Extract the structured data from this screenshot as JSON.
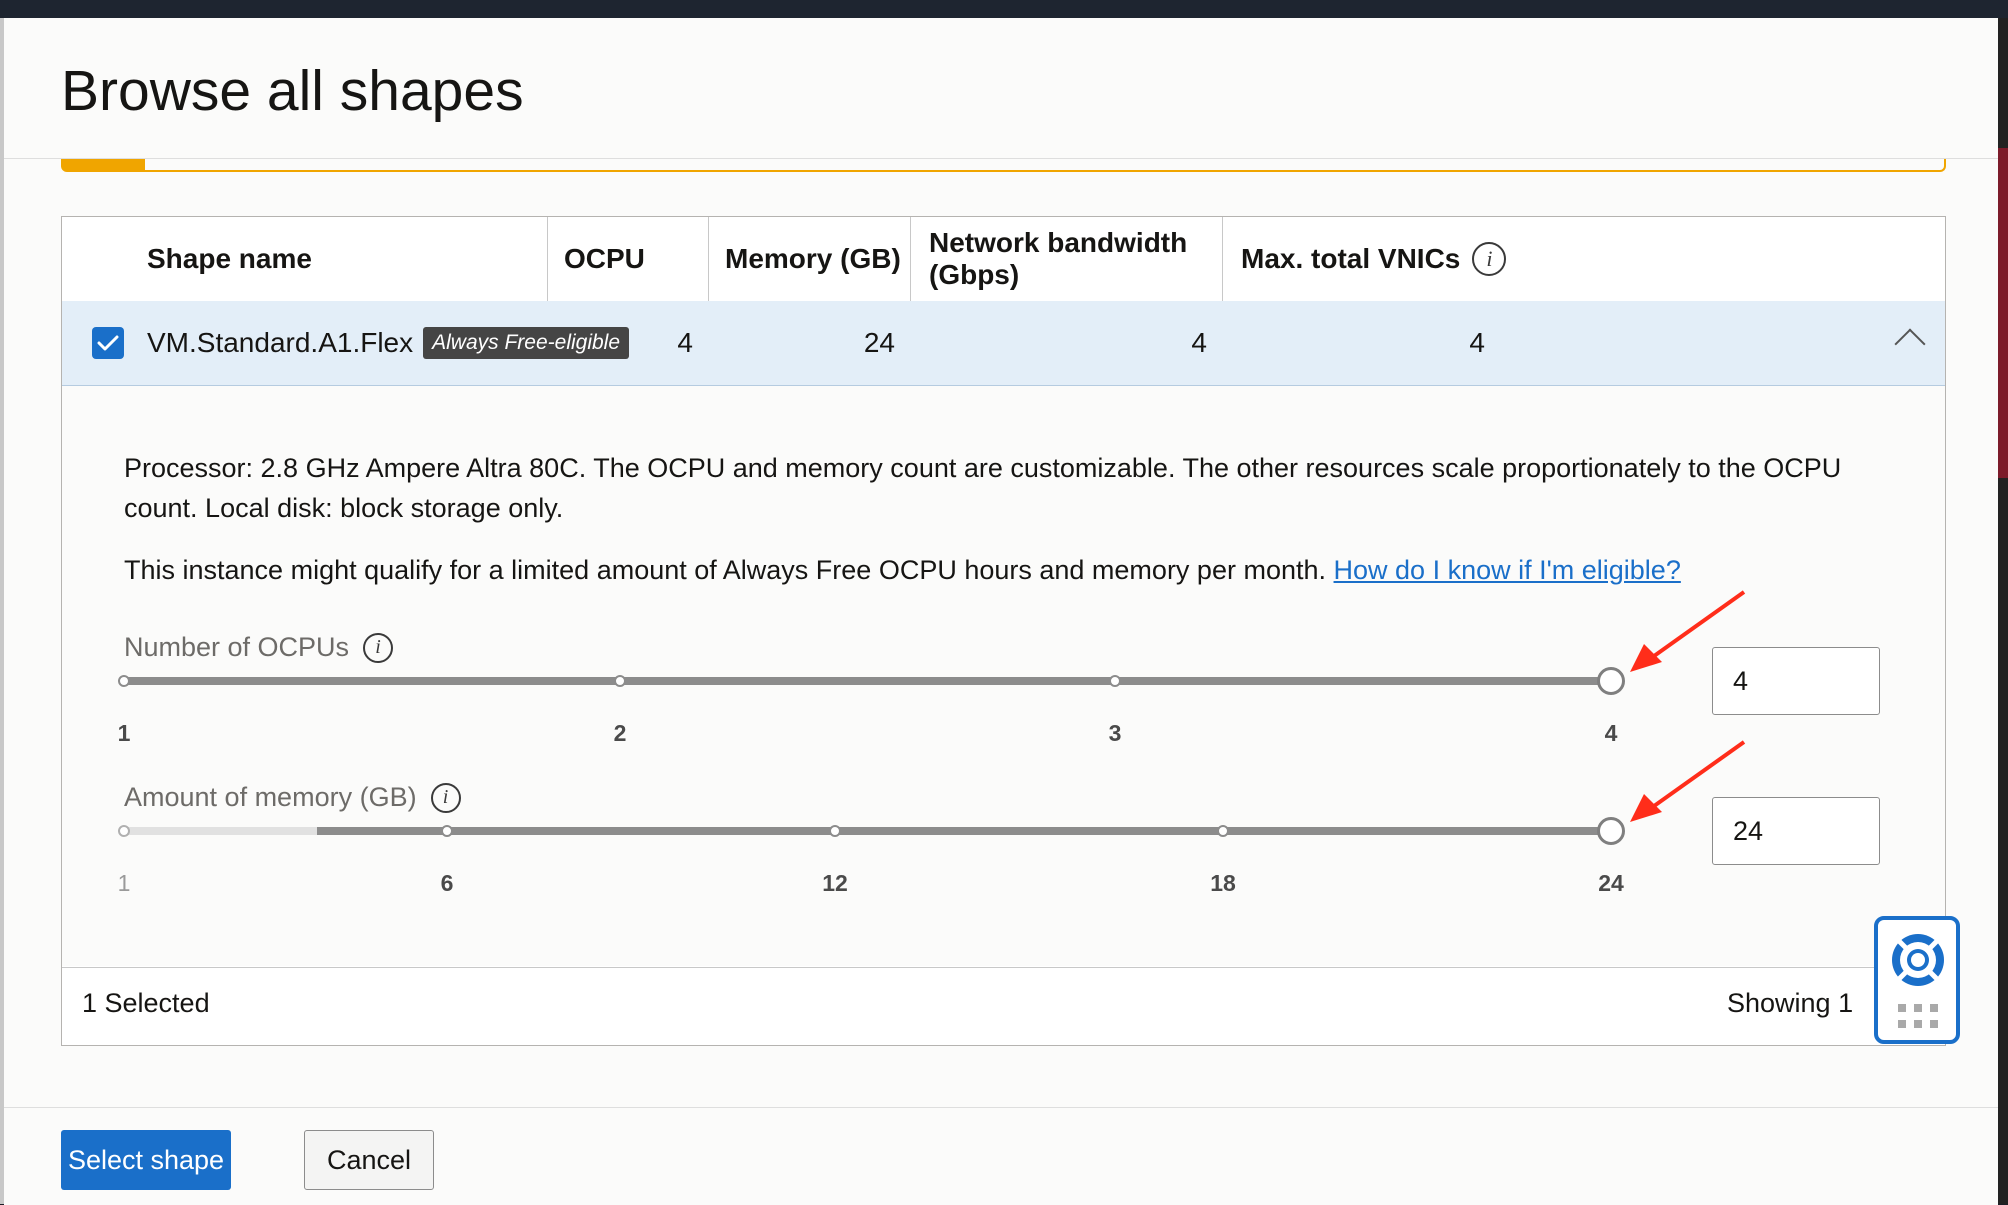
{
  "dialog": {
    "title": "Browse all shapes"
  },
  "table": {
    "columns": [
      "Shape name",
      "OCPU",
      "Memory (GB)",
      "Network bandwidth (Gbps)",
      "Max. total VNICs"
    ],
    "row": {
      "selected": true,
      "shape_name": "VM.Standard.A1.Flex",
      "badge": "Always Free-eligible",
      "ocpu": "4",
      "memory": "24",
      "network_bandwidth": "4",
      "max_vnics": "4"
    },
    "details": {
      "description": "Processor: 2.8 GHz Ampere Altra 80C. The OCPU and memory count are customizable. The other resources scale proportionately to the OCPU count. Local disk: block storage only.",
      "free_tier_note": "This instance might qualify for a limited amount of Always Free OCPU hours and memory per month.",
      "eligibility_link": "How do I know if I'm eligible?",
      "ocpu_slider": {
        "label": "Number of OCPUs",
        "ticks": [
          "1",
          "2",
          "3",
          "4"
        ],
        "value": "4",
        "fraction": 1.0
      },
      "memory_slider": {
        "label": "Amount of memory (GB)",
        "ticks": [
          "1",
          "6",
          "12",
          "18",
          "24"
        ],
        "value": "24",
        "fraction": 1.0
      }
    },
    "footer": {
      "selected_count": "1 Selected",
      "showing": "Showing 1"
    }
  },
  "buttons": {
    "select_shape": "Select shape",
    "cancel": "Cancel"
  },
  "icons": [
    "info-icon",
    "checkbox-checked-icon",
    "chevron-up-icon",
    "lifebuoy-icon",
    "grid-dots-icon",
    "red-arrow-annotation"
  ],
  "colors": {
    "accent": "#1a6fc9",
    "warning": "#f0a500",
    "selected_row": "#e3eef8",
    "annotation": "#ff2d1a"
  }
}
